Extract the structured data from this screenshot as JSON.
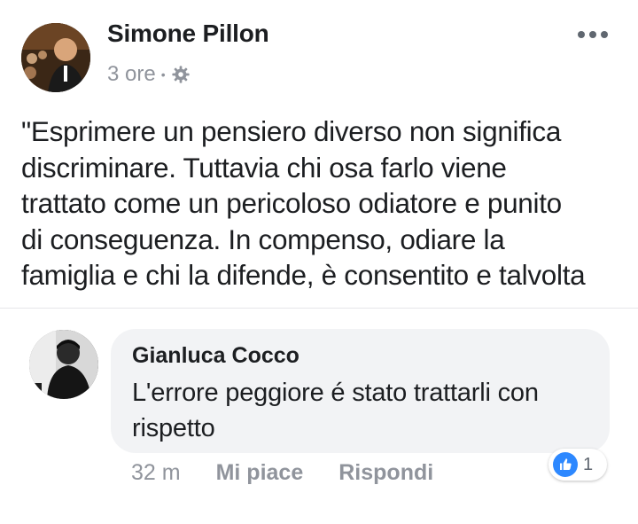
{
  "post": {
    "author": "Simone Pillon",
    "time": "3 ore",
    "separator": "•",
    "audience_icon": "gear-icon",
    "menu_icon": "more-dots-icon",
    "text_lines": [
      "\"Esprimere un pensiero diverso non significa",
      "discriminare. Tuttavia chi osa farlo viene",
      "trattato come un pericoloso odiatore e punito",
      "di conseguenza. In compenso, odiare la",
      "famiglia e chi la difende, è consentito e talvolta"
    ]
  },
  "comment": {
    "author": "Gianluca Cocco",
    "text": "L'errore peggiore é stato trattarli con rispetto",
    "time": "32 m",
    "like_label": "Mi piace",
    "reply_label": "Rispondi",
    "reaction_icon": "like-icon",
    "reaction_count": "1"
  },
  "colors": {
    "text": "#1c1e21",
    "meta": "#90949c",
    "bubble": "#f2f3f5",
    "like_blue": "#2d88ff"
  }
}
